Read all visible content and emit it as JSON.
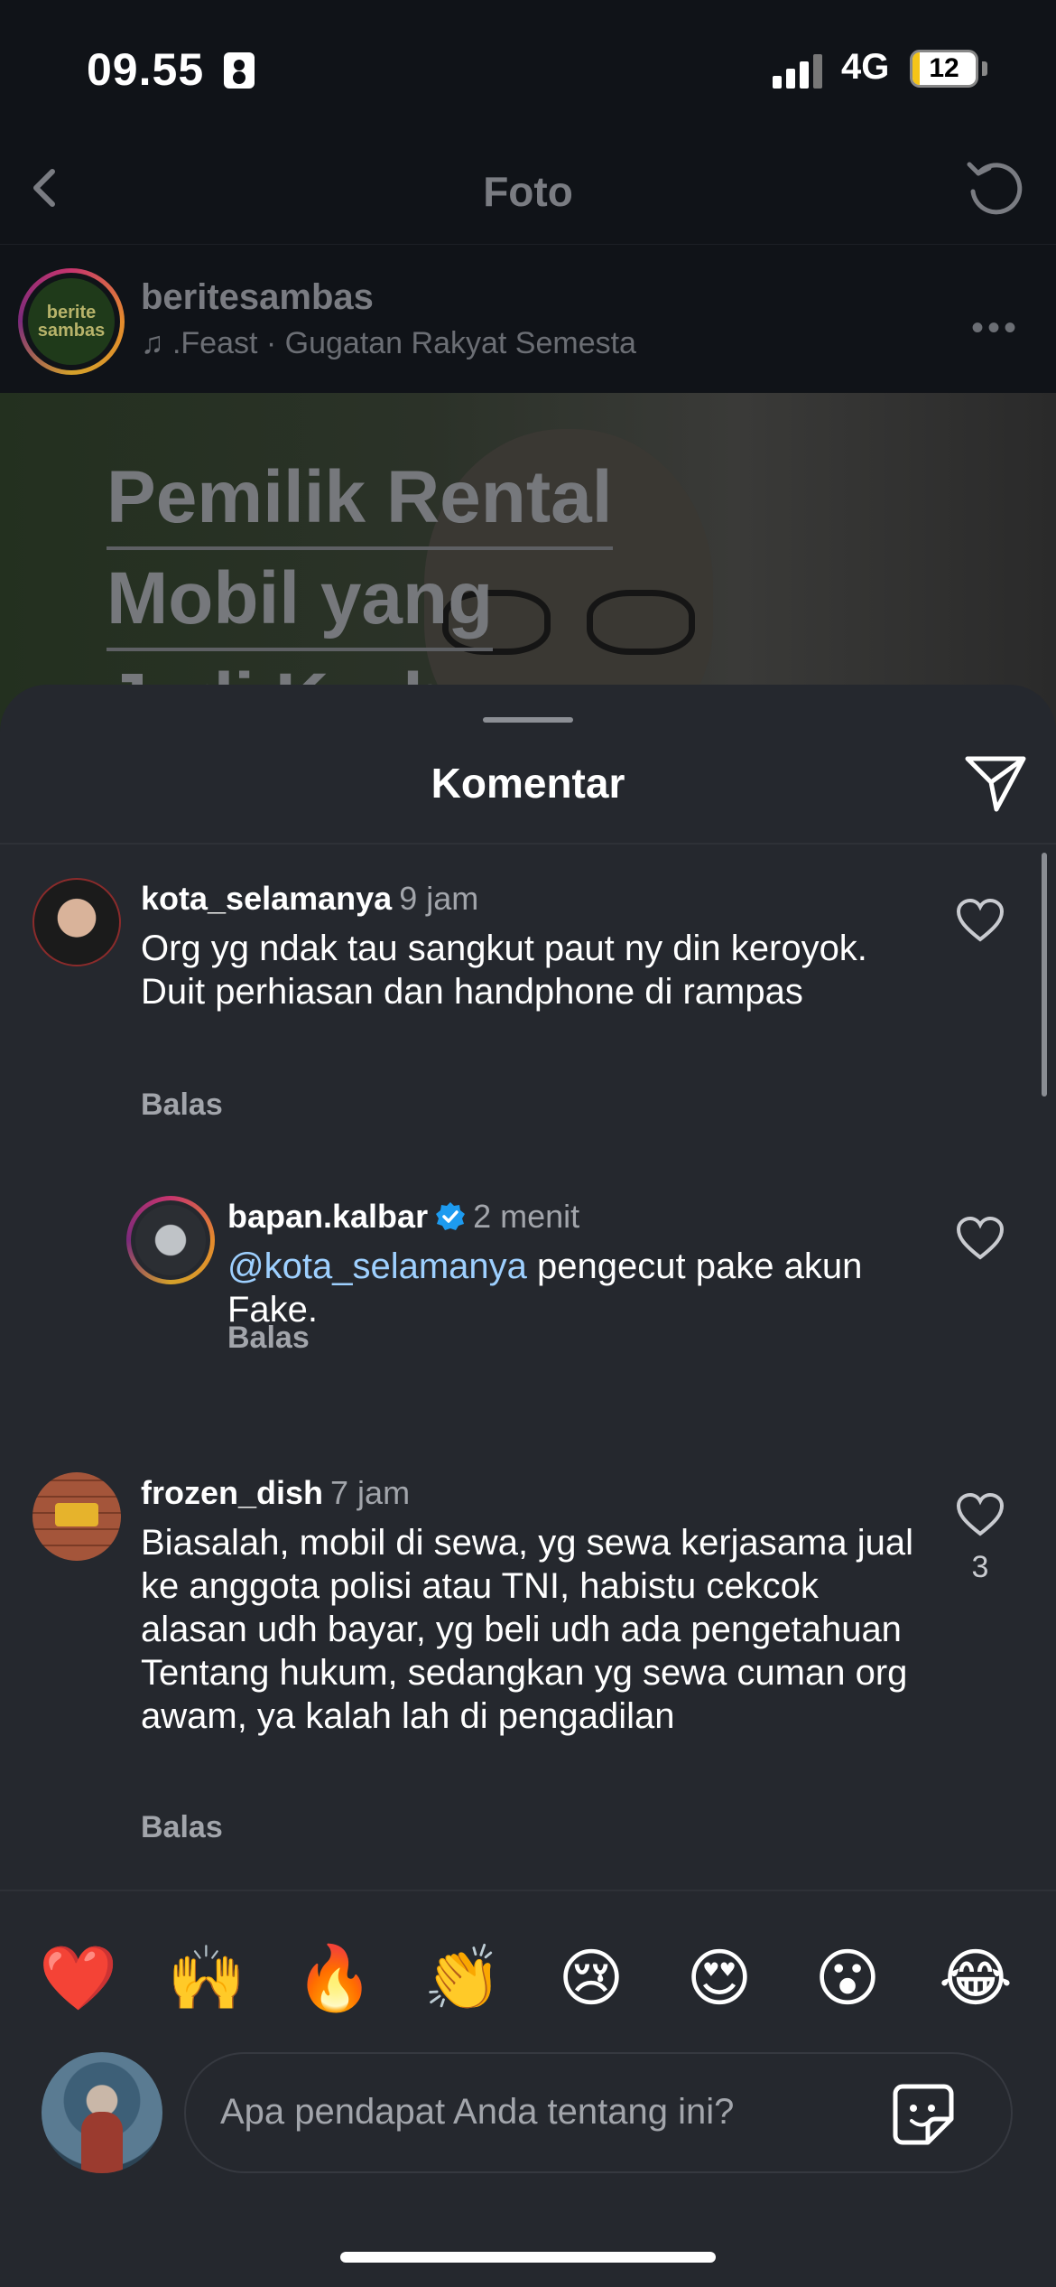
{
  "status_bar": {
    "time": "09.55",
    "network": "4G",
    "battery": "12",
    "battery_level": 0.12
  },
  "nav": {
    "title": "Foto",
    "back_icon": "chevron-left-icon",
    "refresh_icon": "refresh-icon"
  },
  "post": {
    "username": "beritesambas",
    "avatar_text": "berite sambas",
    "music": ".Feast · Gugatan Rakyat Semesta",
    "image_title_lines": [
      "Pemilik Rental",
      "Mobil yang",
      "Jadi Korban"
    ]
  },
  "sheet": {
    "title": "Komentar",
    "share_icon": "send-icon"
  },
  "comments": [
    {
      "username": "kota_selamanya",
      "time": "9 jam",
      "text": "Org yg ndak tau sangkut paut ny din keroyok. Duit perhiasan dan handphone di rampas",
      "reply_label": "Balas",
      "likes": ""
    },
    {
      "username": "bapan.kalbar",
      "verified": true,
      "time": "2 menit",
      "mention": "@kota_selamanya",
      "text": " pengecut pake akun Fake.",
      "reply_label": "Balas",
      "likes": ""
    },
    {
      "username": "frozen_dish",
      "time": "7 jam",
      "text": "Biasalah, mobil di sewa, yg sewa kerjasama jual ke anggota polisi atau TNI, habistu cekcok alasan udh bayar, yg beli udh ada pengetahuan Tentang hukum, sedangkan yg sewa cuman org awam, ya kalah lah di pengadilan",
      "reply_label": "Balas",
      "likes": "3"
    }
  ],
  "emoji_bar": [
    "❤️",
    "🙌",
    "🔥",
    "👏",
    "😢",
    "😍",
    "😮",
    "😂"
  ],
  "input": {
    "placeholder": "Apa pendapat Anda tentang ini?",
    "sticker_icon": "sticker-icon"
  },
  "colors": {
    "sheet_bg": "#25282e",
    "mention": "#9ed0ff",
    "verified": "#1d9bf0"
  }
}
